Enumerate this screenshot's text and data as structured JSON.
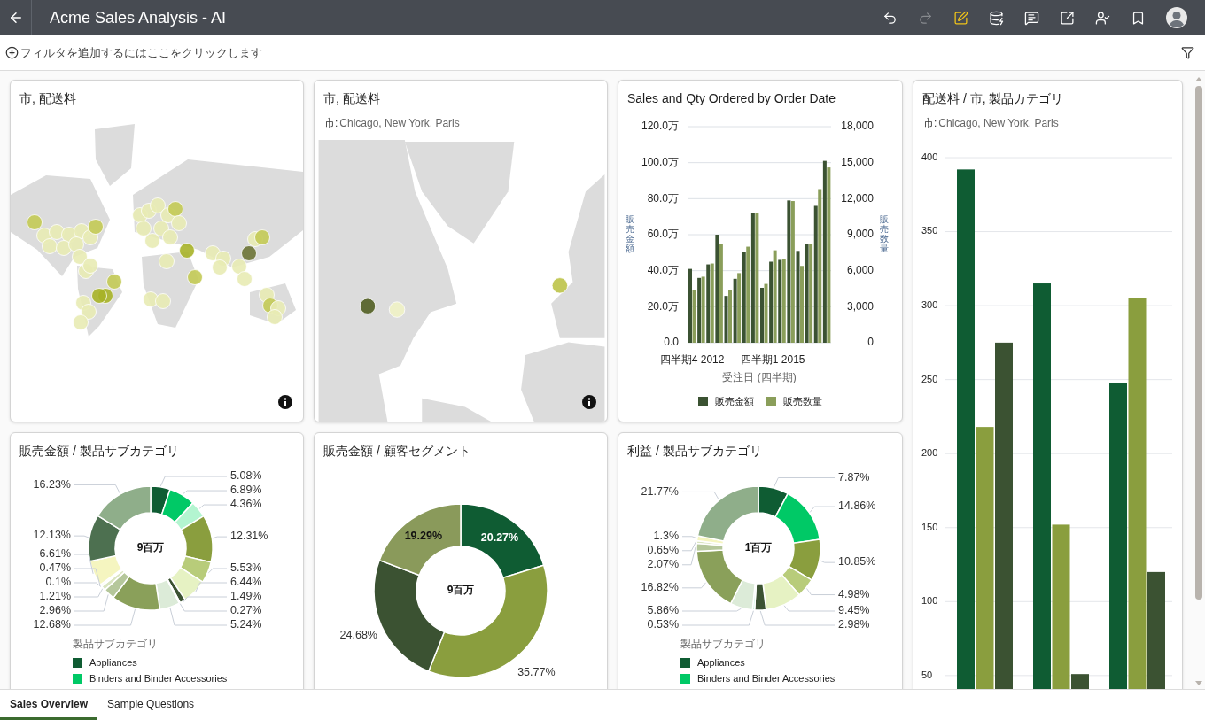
{
  "header": {
    "title": "Acme Sales Analysis - AI",
    "toolbar": [
      {
        "kind": "undo",
        "disabled": false,
        "active": false
      },
      {
        "kind": "redo",
        "disabled": true,
        "active": false
      },
      {
        "kind": "edit",
        "disabled": false,
        "active": true
      },
      {
        "kind": "data",
        "disabled": false,
        "active": false
      },
      {
        "kind": "comment",
        "disabled": false,
        "active": false
      },
      {
        "kind": "export",
        "disabled": false,
        "active": false
      },
      {
        "kind": "share",
        "disabled": false,
        "active": false
      },
      {
        "kind": "bookmark",
        "disabled": false,
        "active": false
      }
    ]
  },
  "filter_bar": {
    "prompt": "フィルタを追加するにはここをクリックします"
  },
  "cards": [
    {
      "kind": "world_map",
      "title": "市, 配送料"
    },
    {
      "kind": "area_map",
      "title": "市, 配送料",
      "filter": {
        "label": "市:",
        "value": "Chicago, New York, Paris"
      }
    },
    {
      "kind": "combo",
      "title": "Sales and Qty Ordered by Order Date",
      "chart_data": {
        "type": "bar",
        "grid": true,
        "xlabel": "受注日 (四半期)",
        "ylabel": "販売金額",
        "categories": [
          "四半期4 2012",
          null,
          null,
          null,
          null,
          null,
          null,
          null,
          null,
          "四半期1 2015",
          null,
          null,
          null,
          null,
          null,
          null
        ],
        "ylim": [
          0,
          120
        ],
        "yticks": [
          {
            "value": 0,
            "label": "0.0"
          },
          {
            "value": 20,
            "label": "20.0万"
          },
          {
            "value": 40,
            "label": "40.0万"
          },
          {
            "value": 60,
            "label": "60.0万"
          },
          {
            "value": 80,
            "label": "80.0万"
          },
          {
            "value": 100,
            "label": "100.0万"
          },
          {
            "value": 120,
            "label": "120.0万"
          }
        ],
        "series": [
          {
            "name": "販売金額",
            "color": "#3b5232",
            "values": [
              41,
              36,
              43.5,
              60,
              26,
              35.5,
              50.5,
              72,
              30.5,
              45,
              46,
              79,
              51,
              55,
              76,
              101
            ]
          }
        ]
      },
      "right_axis": {
        "label": "販売数量",
        "chart_data": {
          "type": "bar",
          "ylim": [
            0,
            18000
          ],
          "yticks": [
            {
              "value": 0,
              "label": "0"
            },
            {
              "value": 3000,
              "label": "3,000"
            },
            {
              "value": 6000,
              "label": "6,000"
            },
            {
              "value": 9000,
              "label": "9,000"
            },
            {
              "value": 12000,
              "label": "12,000"
            },
            {
              "value": 15000,
              "label": "15,000"
            },
            {
              "value": 18000,
              "label": "18,000"
            }
          ],
          "series": [
            {
              "name": "販売数量",
              "color": "#8a9e5a",
              "values": [
                4400,
                5500,
                6600,
                8200,
                4400,
                5800,
                8000,
                10800,
                4900,
                7700,
                7000,
                11800,
                6400,
                8200,
                12800,
                14600
              ]
            }
          ]
        }
      }
    },
    {
      "kind": "bar",
      "title": "配送料 / 市, 製品カテゴリ",
      "filter": {
        "label": "市:",
        "value": "Chicago, New York, Paris"
      },
      "chart_data": {
        "type": "bar",
        "grid": true,
        "ylim": [
          0,
          400
        ],
        "yticks": [
          50,
          100,
          150,
          200,
          250,
          300,
          350,
          400
        ],
        "series": [
          {
            "color": "#0f5c33",
            "values": [
              392,
              315,
              248
            ]
          },
          {
            "color": "#8a9e3e",
            "values": [
              218,
              152,
              305
            ]
          },
          {
            "color": "#3b5232",
            "values": [
              275,
              51,
              120
            ]
          }
        ]
      }
    },
    {
      "kind": "donut",
      "title": "販売金額 / 製品サブカテゴリ",
      "center_label": "9百万",
      "chart_data": {
        "type": "donut",
        "values": [
          5.08,
          6.89,
          4.36,
          12.31,
          5.53,
          6.44,
          1.49,
          0.27,
          5.24,
          12.68,
          2.96,
          1.21,
          0.1,
          0.47,
          6.61,
          12.13,
          16.23
        ],
        "value_labels": [
          "5.08%",
          "6.89%",
          "4.36%",
          "12.31%",
          "5.53%",
          "6.44%",
          "1.49%",
          "0.27%",
          "5.24%",
          "12.68%",
          "2.96%",
          "1.21%",
          "0.1%",
          "0.47%",
          "6.61%",
          "12.13%",
          "16.23%"
        ],
        "colors": [
          "#0f5c33",
          "#00c966",
          "#b3f5d0",
          "#8a9e3e",
          "#b8cc7a",
          "#e6f2c3",
          "#3b5232",
          "#9aa884",
          "#dcebd8",
          "#8aa05a",
          "#b5c79b",
          "#d9e4c0",
          "#eef0d8",
          "#f7f7dc",
          "#f5f5c0",
          "#4d7050",
          "#8fae8a"
        ]
      },
      "legend": {
        "title": "製品サブカテゴリ",
        "items": [
          {
            "label": "Appliances",
            "color": "#0f5c33"
          },
          {
            "label": "Binders and Binder Accessories",
            "color": "#00c966"
          }
        ]
      }
    },
    {
      "kind": "donut",
      "title": "販売金額 / 顧客セグメント",
      "center_label": "9百万",
      "chart_data": {
        "type": "donut",
        "values": [
          20.27,
          35.77,
          24.68,
          19.29
        ],
        "value_labels": [
          "20.27%",
          "35.77%",
          "24.68%",
          "19.29%"
        ],
        "colors": [
          "#0f5c33",
          "#8a9e3e",
          "#3b5232",
          "#8a9a5b"
        ]
      }
    },
    {
      "kind": "donut",
      "title": "利益 / 製品サブカテゴリ",
      "center_label": "1百万",
      "chart_data": {
        "type": "donut",
        "values": [
          7.87,
          14.86,
          10.85,
          4.98,
          9.45,
          2.98,
          0.53,
          5.86,
          16.82,
          2.07,
          0.65,
          1.3,
          21.77
        ],
        "value_labels": [
          "7.87%",
          "14.86%",
          "10.85%",
          "4.98%",
          "9.45%",
          "2.98%",
          "0.53%",
          "5.86%",
          "16.82%",
          "2.07%",
          "0.65%",
          "1.3%",
          "21.77%"
        ],
        "colors": [
          "#0f5c33",
          "#00c966",
          "#8a9e3e",
          "#b8cc7a",
          "#e6f2c3",
          "#3b5232",
          "#b3f5d0",
          "#dcebd8",
          "#8aa05a",
          "#b5c79b",
          "#d9e4c0",
          "#f5f5c0",
          "#8fae8a"
        ]
      },
      "legend": {
        "title": "製品サブカテゴリ",
        "items": [
          {
            "label": "Appliances",
            "color": "#0f5c33"
          },
          {
            "label": "Binders and Binder Accessories",
            "color": "#00c966"
          }
        ]
      }
    }
  ],
  "tabs": [
    {
      "label": "Sales Overview",
      "selected": true
    },
    {
      "label": "Sample Questions",
      "selected": false
    }
  ]
}
